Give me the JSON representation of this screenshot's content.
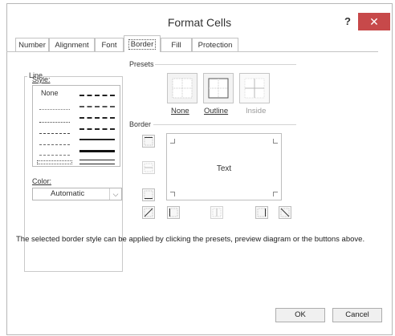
{
  "window": {
    "title": "Format Cells",
    "help_label": "?",
    "close_label": "✕"
  },
  "tabs": [
    {
      "label": "Number"
    },
    {
      "label": "Alignment"
    },
    {
      "label": "Font"
    },
    {
      "label": "Border",
      "active": true
    },
    {
      "label": "Fill"
    },
    {
      "label": "Protection"
    }
  ],
  "line_group": {
    "label": "Line",
    "style_label": "Style:",
    "style_none": "None",
    "color_label": "Color:",
    "color_value": "Automatic"
  },
  "presets": {
    "label": "Presets",
    "items": [
      {
        "label": "None"
      },
      {
        "label": "Outline"
      },
      {
        "label": "Inside"
      }
    ]
  },
  "border": {
    "label": "Border",
    "preview_text": "Text"
  },
  "description": "The selected border style can be applied by clicking the presets, preview diagram or the buttons above.",
  "buttons": {
    "ok": "OK",
    "cancel": "Cancel"
  }
}
